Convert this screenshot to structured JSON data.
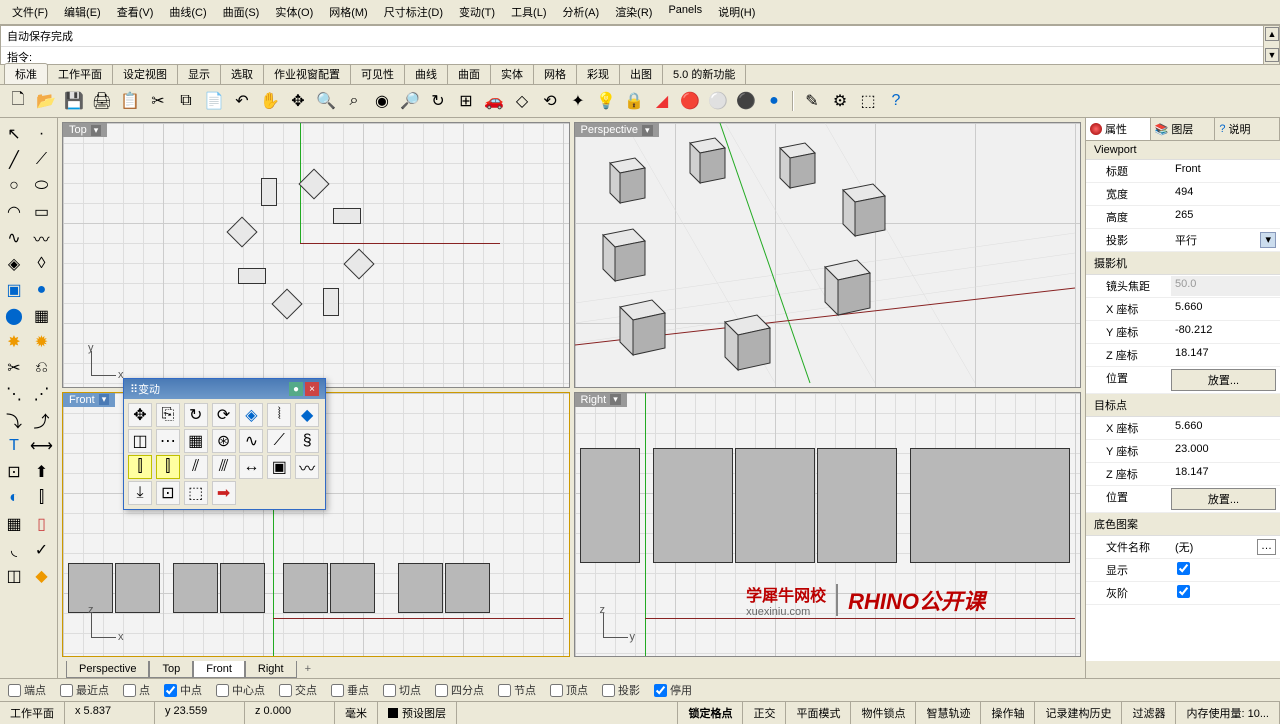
{
  "menu": [
    "文件(F)",
    "编辑(E)",
    "查看(V)",
    "曲线(C)",
    "曲面(S)",
    "实体(O)",
    "网格(M)",
    "尺寸标注(D)",
    "变动(T)",
    "工具(L)",
    "分析(A)",
    "渲染(R)",
    "Panels",
    "说明(H)"
  ],
  "command_history": "自动保存完成",
  "command_prompt": "指令:",
  "tabs": [
    "标准",
    "工作平面",
    "设定视图",
    "显示",
    "选取",
    "作业视窗配置",
    "可见性",
    "曲线",
    "曲面",
    "实体",
    "网格",
    "彩现",
    "出图",
    "5.0 的新功能"
  ],
  "viewports": {
    "top": "Top",
    "perspective": "Perspective",
    "front": "Front",
    "right": "Right"
  },
  "vp_tabs": [
    "Perspective",
    "Top",
    "Front",
    "Right"
  ],
  "vp_tabs_active": 2,
  "float_palette": {
    "title": "变动"
  },
  "right_panel": {
    "tabs": [
      "属性",
      "图层",
      "说明"
    ],
    "viewport_h": "Viewport",
    "rows1": [
      {
        "l": "标题",
        "v": "Front"
      },
      {
        "l": "宽度",
        "v": "494"
      },
      {
        "l": "高度",
        "v": "265"
      },
      {
        "l": "投影",
        "v": "平行",
        "dd": true
      }
    ],
    "camera_h": "摄影机",
    "rows2": [
      {
        "l": "镜头焦距",
        "v": "50.0",
        "dis": true
      },
      {
        "l": "X 座标",
        "v": "5.660"
      },
      {
        "l": "Y 座标",
        "v": "-80.212"
      },
      {
        "l": "Z 座标",
        "v": "18.147"
      },
      {
        "l": "位置",
        "v": "放置...",
        "btn": true
      }
    ],
    "target_h": "目标点",
    "rows3": [
      {
        "l": "X 座标",
        "v": "5.660"
      },
      {
        "l": "Y 座标",
        "v": "23.000"
      },
      {
        "l": "Z 座标",
        "v": "18.147"
      },
      {
        "l": "位置",
        "v": "放置...",
        "btn": true
      }
    ],
    "wallpaper_h": "底色图案",
    "rows4": [
      {
        "l": "文件名称",
        "v": "(无)",
        "browse": true
      },
      {
        "l": "显示",
        "v": "",
        "chk": true
      },
      {
        "l": "灰阶",
        "v": "",
        "chk": true
      }
    ]
  },
  "osnap": [
    {
      "l": "端点",
      "c": false
    },
    {
      "l": "最近点",
      "c": false
    },
    {
      "l": "点",
      "c": false
    },
    {
      "l": "中点",
      "c": true
    },
    {
      "l": "中心点",
      "c": false
    },
    {
      "l": "交点",
      "c": false
    },
    {
      "l": "垂点",
      "c": false
    },
    {
      "l": "切点",
      "c": false
    },
    {
      "l": "四分点",
      "c": false
    },
    {
      "l": "节点",
      "c": false
    },
    {
      "l": "顶点",
      "c": false
    },
    {
      "l": "投影",
      "c": false
    },
    {
      "l": "停用",
      "c": true
    }
  ],
  "status": {
    "cplane": "工作平面",
    "x": "x 5.837",
    "y": "y 23.559",
    "z": "z 0.000",
    "units": "毫米",
    "layer": "预设图层",
    "toggles": [
      "锁定格点",
      "正交",
      "平面模式",
      "物件锁点",
      "智慧轨迹",
      "操作轴",
      "记录建构历史",
      "过滤器"
    ],
    "mem": "内存使用量: 10..."
  },
  "watermark": {
    "cn": "学犀牛网校",
    "url": "xuexiniu.com",
    "en": "RHINO公开课"
  }
}
